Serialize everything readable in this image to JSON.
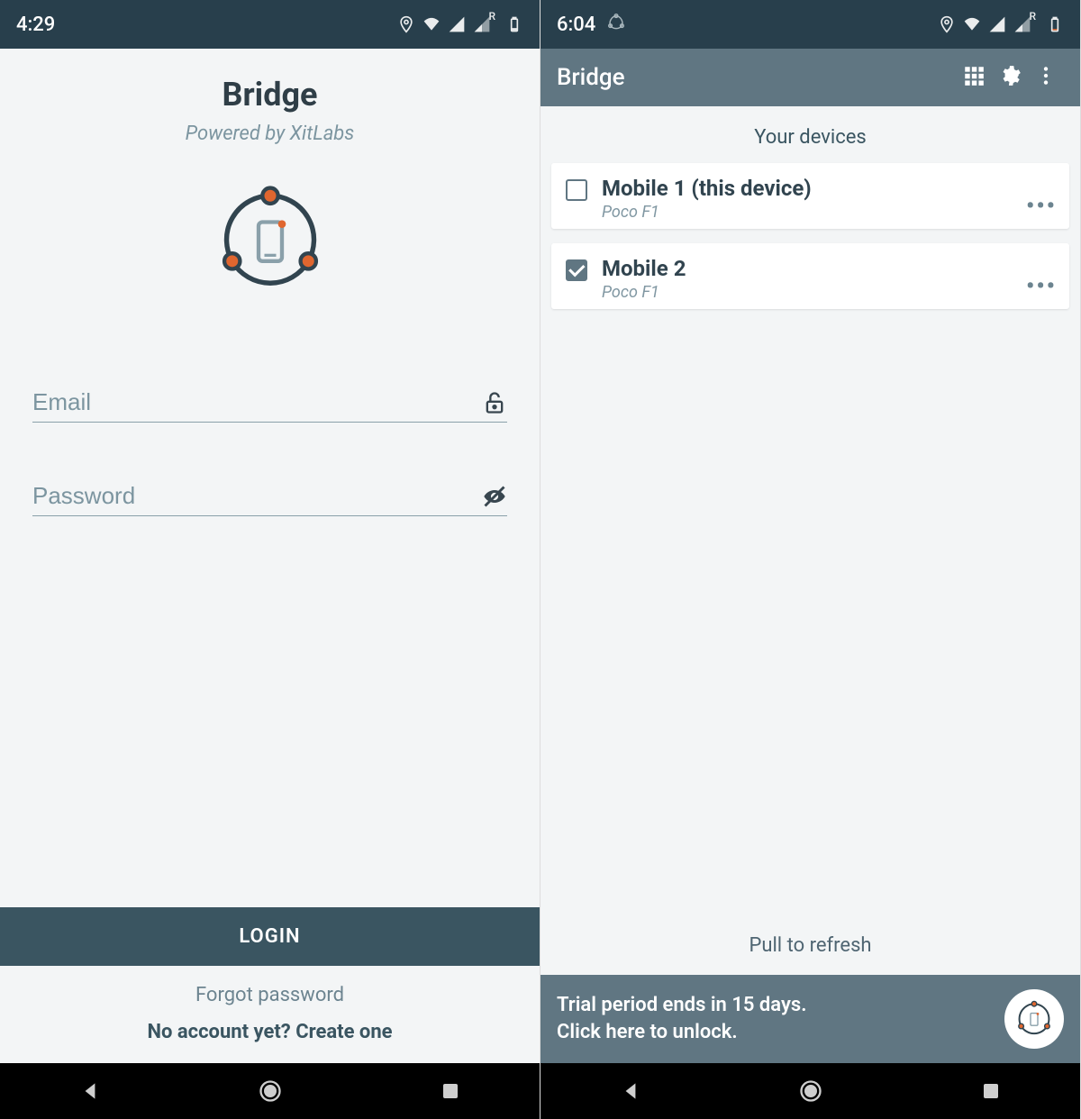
{
  "left": {
    "status": {
      "time": "4:29"
    },
    "header": {
      "title": "Bridge",
      "subtitle": "Powered by XitLabs"
    },
    "form": {
      "email_placeholder": "Email",
      "password_placeholder": "Password"
    },
    "actions": {
      "login": "LOGIN",
      "forgot": "Forgot password",
      "create": "No account yet? Create one"
    }
  },
  "right": {
    "status": {
      "time": "6:04"
    },
    "appbar": {
      "title": "Bridge"
    },
    "section_title": "Your devices",
    "devices": [
      {
        "name": "Mobile 1 (this device)",
        "model": "Poco F1",
        "checked": false
      },
      {
        "name": "Mobile 2",
        "model": "Poco F1",
        "checked": true
      }
    ],
    "pull_to_refresh": "Pull to refresh",
    "trial": {
      "line1": "Trial period ends in 15 days.",
      "line2": "Click here to unlock."
    }
  }
}
